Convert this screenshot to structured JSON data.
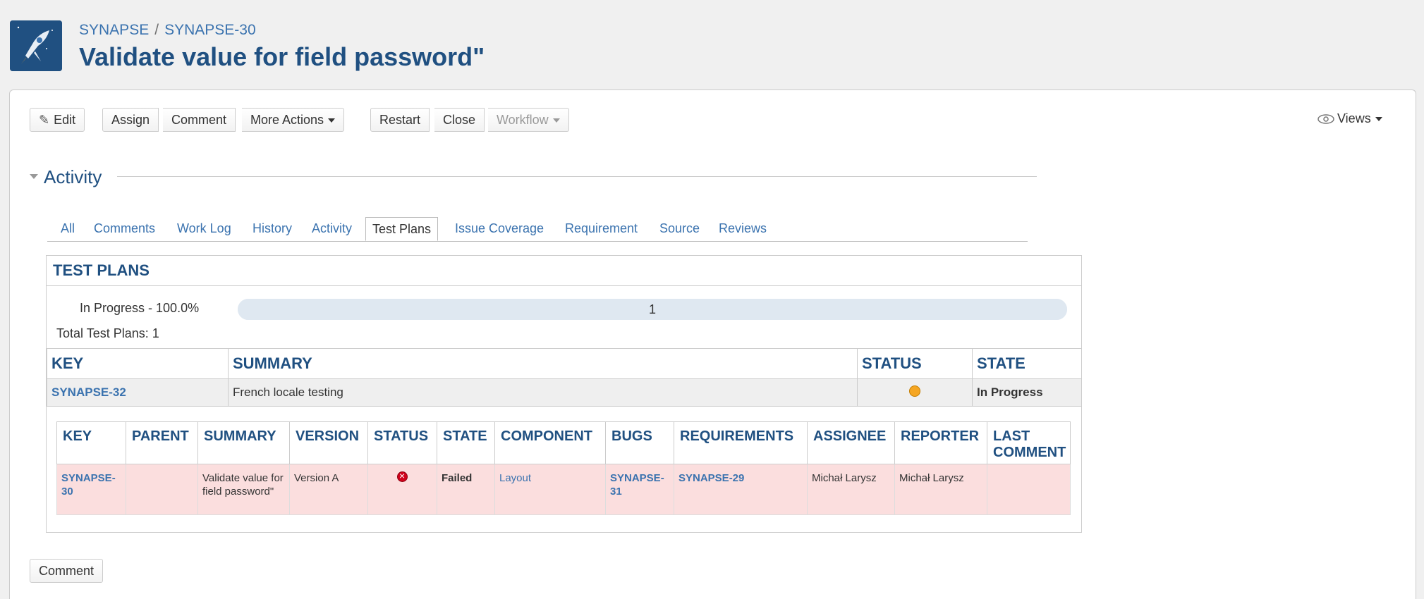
{
  "breadcrumb": {
    "project": "SYNAPSE",
    "separator": "/",
    "issue": "SYNAPSE-30"
  },
  "title": "Validate value for field password\"",
  "toolbar": {
    "edit": "Edit",
    "assign": "Assign",
    "comment": "Comment",
    "more_actions": "More Actions",
    "restart": "Restart",
    "close": "Close",
    "workflow": "Workflow",
    "views": "Views"
  },
  "activity": {
    "title": "Activity",
    "tabs": [
      "All",
      "Comments",
      "Work Log",
      "History",
      "Activity",
      "Test Plans",
      "Issue Coverage",
      "Requirement",
      "Source",
      "Reviews"
    ],
    "active_tab": "Test Plans"
  },
  "test_plans": {
    "title": "TEST PLANS",
    "progress_label": "In Progress - 100.0%",
    "progress_fraction": 1.0,
    "progress_count": "1",
    "total": "Total Test Plans: 1",
    "columns": [
      "KEY",
      "SUMMARY",
      "STATUS",
      "STATE"
    ],
    "plan": {
      "key": "SYNAPSE-32",
      "summary": "French locale testing",
      "status_icon": "in-progress-icon",
      "state": "In Progress"
    },
    "cases": {
      "columns": [
        "KEY",
        "PARENT",
        "SUMMARY",
        "VERSION",
        "STATUS",
        "STATE",
        "COMPONENT",
        "BUGS",
        "REQUIREMENTS",
        "ASSIGNEE",
        "REPORTER",
        "LAST COMMENT"
      ],
      "rows": [
        {
          "key": "SYNAPSE-30",
          "parent": "",
          "summary": "Validate value for field password\"",
          "version": "Version A",
          "status_icon": "failed-icon",
          "state": "Failed",
          "component": "Layout",
          "bugs": "SYNAPSE-31",
          "requirements": "SYNAPSE-29",
          "assignee": "Michał Larysz",
          "reporter": "Michał Larysz",
          "last_comment": ""
        }
      ]
    }
  },
  "bottom": {
    "comment": "Comment"
  },
  "colors": {
    "link": "#3b73af",
    "heading": "#205081",
    "failed_row": "#fbdede"
  }
}
